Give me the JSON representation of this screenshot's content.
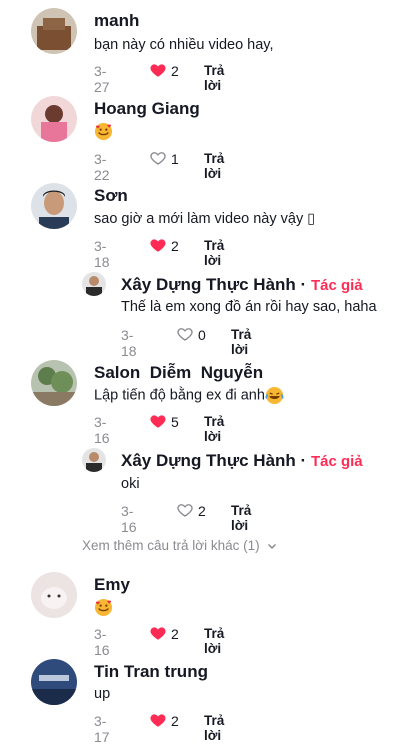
{
  "comments": [
    {
      "name": "manh",
      "text": "bạn này có nhiều video hay,",
      "date": "3-27",
      "likes": "2",
      "liked": true,
      "reply_label": "Trả lời"
    },
    {
      "name": "Hoang Giang",
      "text": "",
      "date": "3-22",
      "likes": "1",
      "liked": false,
      "reply_label": "Trả lời",
      "emoji": "smiling-face-with-hearts"
    },
    {
      "name": "Sơn",
      "text": "sao giờ a mới làm video này vậy ▯",
      "date": "3-18",
      "likes": "2",
      "liked": true,
      "reply_label": "Trả lời"
    },
    {
      "name": "Xây Dựng Thực Hành",
      "separator": "·",
      "author_tag": "Tác giả",
      "text": "Thế là em xong đồ án rồi hay sao, haha",
      "date": "3-18",
      "likes": "0",
      "liked": false,
      "reply_label": "Trả lời"
    },
    {
      "name": "Salon  Diễm  Nguyễn",
      "text": "Lập tiến độ bằng ex đi anh",
      "date": "3-16",
      "likes": "5",
      "liked": true,
      "reply_label": "Trả lời",
      "emoji": "face-with-tears-of-joy"
    },
    {
      "name": "Xây Dựng Thực Hành",
      "separator": "·",
      "author_tag": "Tác giả",
      "text": "oki",
      "date": "3-16",
      "likes": "2",
      "liked": false,
      "reply_label": "Trả lời"
    },
    {
      "name": "Emy",
      "text": "",
      "date": "3-16",
      "likes": "2",
      "liked": true,
      "reply_label": "Trả lời",
      "emoji": "smiling-face-with-hearts"
    },
    {
      "name": "Tin Tran trung",
      "text": "up",
      "date": "3-17",
      "likes": "2",
      "liked": true,
      "reply_label": "Trả lời"
    }
  ],
  "view_more": "Xem thêm câu trả lời khác (1)",
  "colors": {
    "accent": "#fe2c55",
    "muted": "#8a8b91",
    "text": "#161823"
  }
}
